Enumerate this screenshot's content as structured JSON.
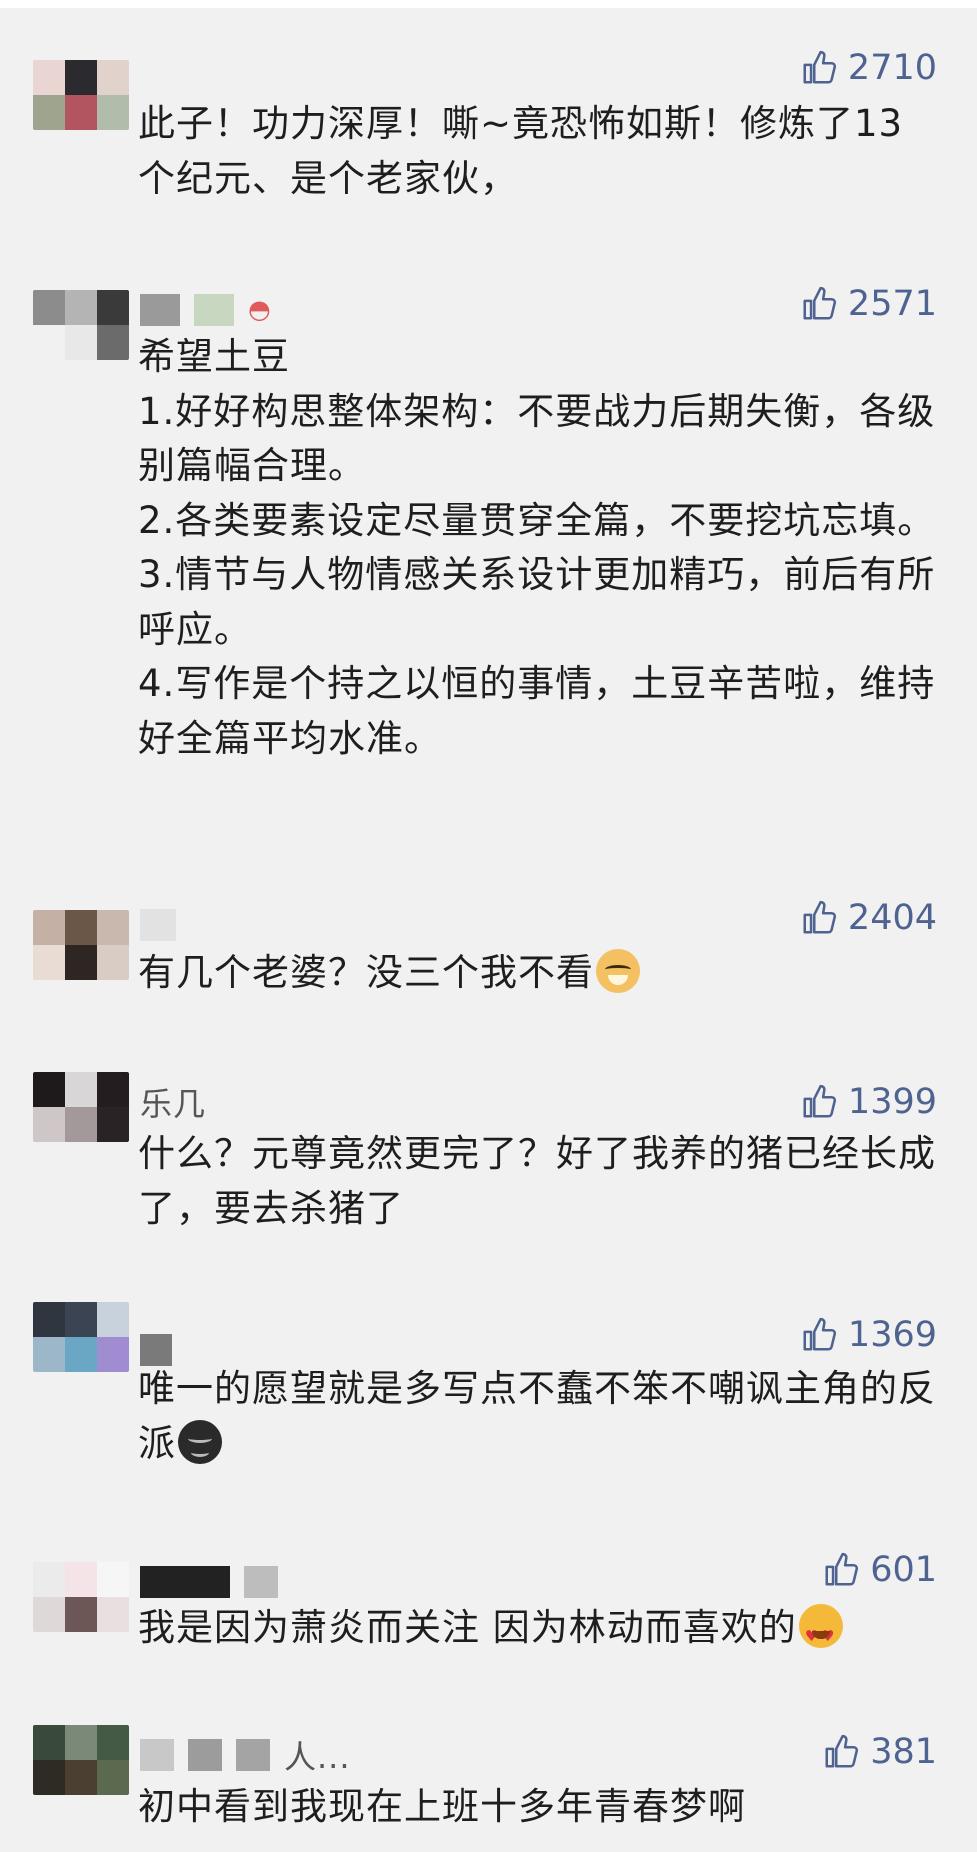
{
  "colors": {
    "background": "#f1f1f1",
    "like_color": "#4f6391",
    "text_color": "#1e1e1e"
  },
  "comments": [
    {
      "likes": "2710",
      "username": "",
      "text": "此子！功力深厚！嘶~竟恐怖如斯！修炼了13个纪元、是个老家伙，",
      "emoji": ""
    },
    {
      "likes": "2571",
      "username": "",
      "text": "希望土豆\n1.好好构思整体架构：不要战力后期失衡，各级别篇幅合理。\n2.各类要素设定尽量贯穿全篇，不要挖坑忘填。\n3.情节与人物情感关系设计更加精巧，前后有所呼应。\n4.写作是个持之以恒的事情，土豆辛苦啦，维持好全篇平均水准。",
      "emoji": ""
    },
    {
      "likes": "2404",
      "username": "",
      "text": "有几个老婆？没三个我不看",
      "emoji": "doge-icon"
    },
    {
      "likes": "1399",
      "username": "乐几",
      "text": "什么？元尊竟然更完了？好了我养的猪已经长成了，要去杀猪了",
      "emoji": ""
    },
    {
      "likes": "1369",
      "username": "",
      "text": "唯一的愿望就是多写点不蠢不笨不嘲讽主角的反派",
      "emoji": "dark-face-icon"
    },
    {
      "likes": "601",
      "username": "",
      "text": "我是因为萧炎而关注 因为林动而喜欢的",
      "emoji": "heart-eyes-icon"
    },
    {
      "likes": "381",
      "username": "人...",
      "text": "初中看到我现在上班十多年青春梦啊",
      "emoji": ""
    }
  ]
}
